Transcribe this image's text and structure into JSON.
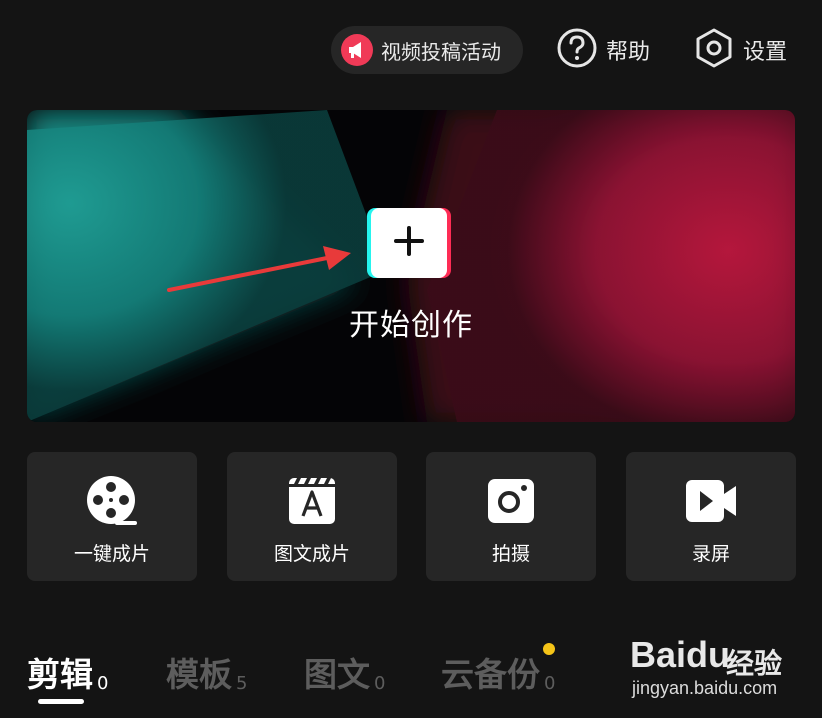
{
  "header": {
    "promo_label": "视频投稿活动",
    "help_label": "帮助",
    "settings_label": "设置"
  },
  "hero": {
    "create_label": "开始创作"
  },
  "actions": [
    {
      "label": "一键成片",
      "icon": "film-reel-icon"
    },
    {
      "label": "图文成片",
      "icon": "clapperboard-text-icon"
    },
    {
      "label": "拍摄",
      "icon": "camera-icon"
    },
    {
      "label": "录屏",
      "icon": "video-camera-icon"
    }
  ],
  "tabs": [
    {
      "label": "剪辑",
      "count": "0",
      "active": true
    },
    {
      "label": "模板",
      "count": "5",
      "active": false
    },
    {
      "label": "图文",
      "count": "0",
      "active": false
    },
    {
      "label": "云备份",
      "count": "0",
      "active": false
    }
  ],
  "watermark": {
    "brand_latin": "Baidu",
    "brand_cn": "经验",
    "url": "jingyan.baidu.com"
  },
  "colors": {
    "background": "#141414",
    "card": "#262626",
    "accent_red": "#fe2c55",
    "accent_cyan": "#25f4ee",
    "badge_dot": "#f5c418"
  }
}
